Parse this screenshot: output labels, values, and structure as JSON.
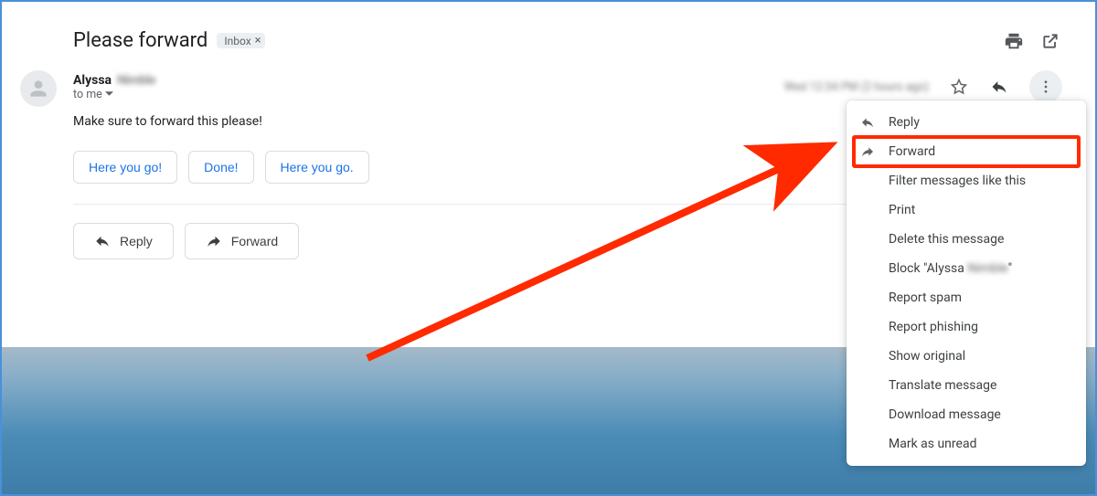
{
  "header": {
    "subject": "Please forward",
    "label": "Inbox"
  },
  "sender": {
    "first_name": "Alyssa",
    "last_name_blur": "Nimble",
    "recipient_label": "to me"
  },
  "meta": {
    "date_blur": "Wed 12:34 PM (2 hours ago)"
  },
  "body_text": "Make sure to forward this please!",
  "smart_replies": [
    "Here you go!",
    "Done!",
    "Here you go."
  ],
  "action_bar": {
    "reply_label": "Reply",
    "forward_label": "Forward"
  },
  "menu": {
    "reply": "Reply",
    "forward": "Forward",
    "filter": "Filter messages like this",
    "print": "Print",
    "delete": "Delete this message",
    "block_prefix": "Block \"Alyssa ",
    "block_blur": "Nimble",
    "block_suffix": "\"",
    "report_spam": "Report spam",
    "report_phishing": "Report phishing",
    "show_original": "Show original",
    "translate": "Translate message",
    "download": "Download message",
    "mark_unread": "Mark as unread"
  }
}
